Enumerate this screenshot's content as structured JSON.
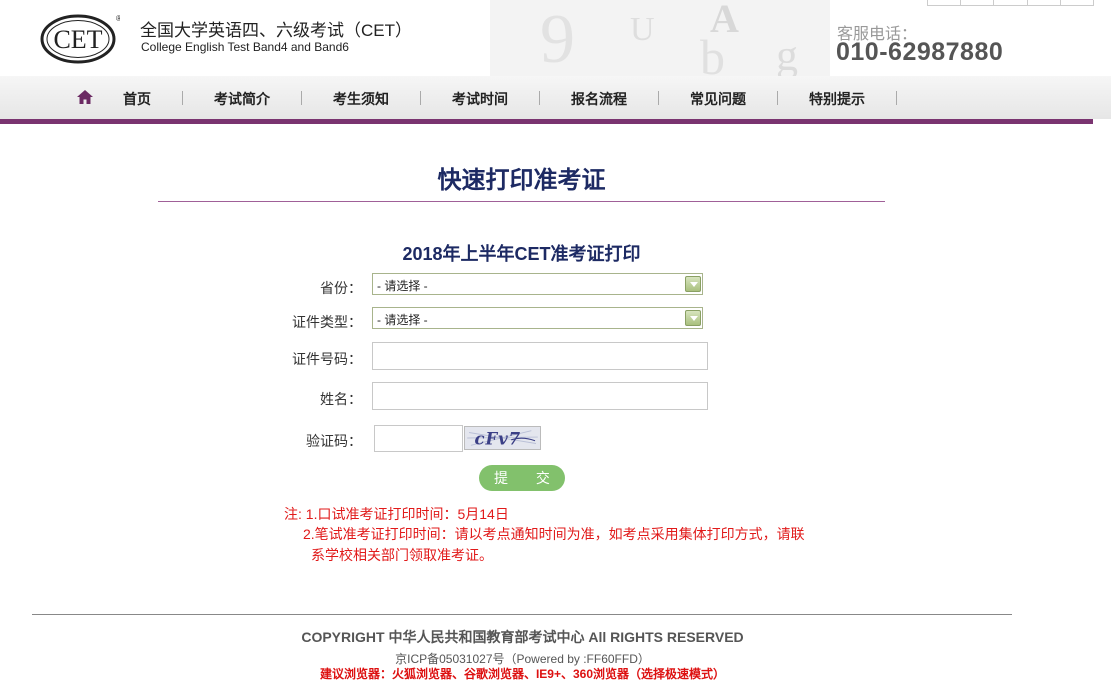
{
  "header": {
    "logo_text": "CET",
    "title_cn": "全国大学英语四、六级考试（CET）",
    "title_en": "College English Test Band4 and Band6",
    "phone_label": "客服电话：",
    "phone_number": "010-62987880"
  },
  "nav": {
    "items": [
      {
        "label": "首页"
      },
      {
        "label": "考试简介"
      },
      {
        "label": "考生须知"
      },
      {
        "label": "考试时间"
      },
      {
        "label": "报名流程"
      },
      {
        "label": "常见问题"
      },
      {
        "label": "特别提示"
      }
    ]
  },
  "main": {
    "page_title": "快速打印准考证",
    "form_title": "2018年上半年CET准考证打印",
    "province": {
      "label": "省份：",
      "selected": "- 请选择  -"
    },
    "id_type": {
      "label": "证件类型：",
      "selected": "- 请选择  -"
    },
    "id_number": {
      "label": "证件号码：",
      "value": ""
    },
    "name": {
      "label": "姓名：",
      "value": ""
    },
    "captcha": {
      "label": "验证码：",
      "value": "",
      "image_text": "cFv7"
    },
    "submit_label": "提 交",
    "notes": [
      "注: 1.口试准考证打印时间：5月14日",
      "2.笔试准考证打印时间：请以考点通知时间为准，如考点采用集体打印方式，请联",
      "系学校相关部门领取准考证。"
    ]
  },
  "footer": {
    "copyright": "COPYRIGHT 中华人民共和国教育部考试中心  All RIGHTS RESERVED",
    "icp": "京ICP备05031027号（Powered by :FF60FFD）",
    "browser_tip": "建议浏览器：火狐浏览器、谷歌浏览器、IE9+、360浏览器（选择极速模式）"
  },
  "colors": {
    "brand_purple": "#7a3470",
    "title_navy": "#1d2a63",
    "submit_green": "#82c16c",
    "note_red": "#e11a1a"
  }
}
